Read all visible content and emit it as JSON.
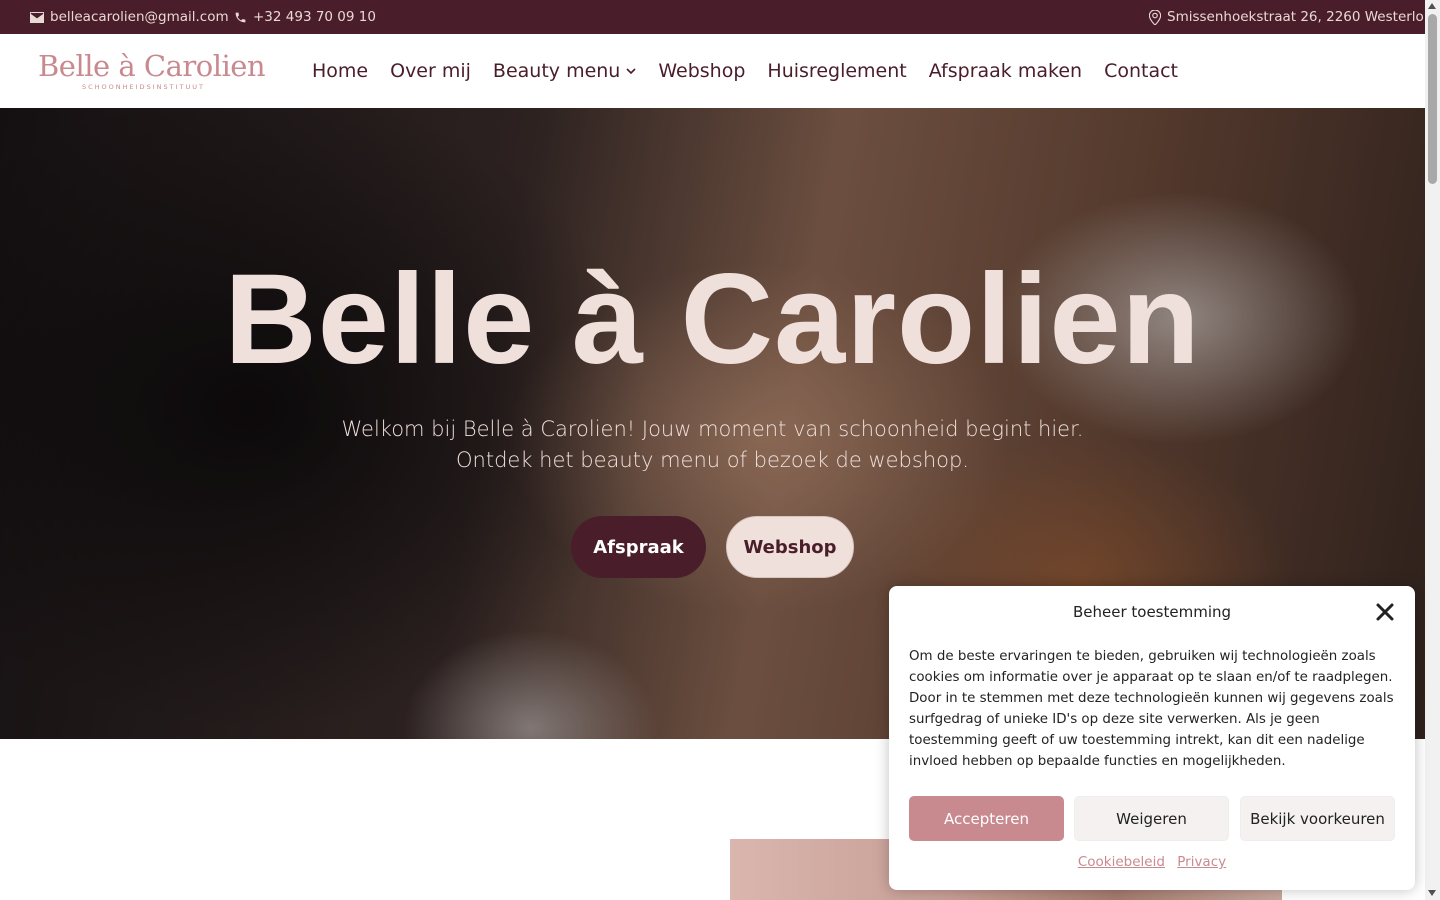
{
  "topbar": {
    "email": "belleacarolien@gmail.com",
    "phone": "+32 493 70 09 10",
    "address": "Smissenhoekstraat 26, 2260 Westerlo"
  },
  "logo": {
    "text": "Belle à Carolien",
    "subtitle": "SCHOONHEIDSINSTITUUT"
  },
  "nav": {
    "items": [
      "Home",
      "Over mij",
      "Beauty menu",
      "Webshop",
      "Huisreglement",
      "Afspraak maken",
      "Contact"
    ]
  },
  "hero": {
    "title": "Belle à Carolien",
    "subtitle_line1": "Welkom bij Belle à Carolien! Jouw moment van schoonheid begint hier.",
    "subtitle_line2": "Ontdek het beauty menu of bezoek de webshop.",
    "primary_button": "Afspraak",
    "secondary_button": "Webshop"
  },
  "cookie": {
    "title": "Beheer toestemming",
    "text": "Om de beste ervaringen te bieden, gebruiken wij technologieën zoals cookies om informatie over je apparaat op te slaan en/of te raadplegen. Door in te stemmen met deze technologieën kunnen wij gegevens zoals surfgedrag of unieke ID's op deze site verwerken. Als je geen toestemming geeft of uw toestemming intrekt, kan dit een nadelige invloed hebben op bepaalde functies en mogelijkheden.",
    "accept": "Accepteren",
    "deny": "Weigeren",
    "preferences": "Bekijk voorkeuren",
    "link_cookie_policy": "Cookiebeleid",
    "link_privacy": "Privacy"
  },
  "colors": {
    "brand_dark": "#4a1d2a",
    "brand_light": "#efe0db",
    "brand_pink": "#c98a8f"
  }
}
